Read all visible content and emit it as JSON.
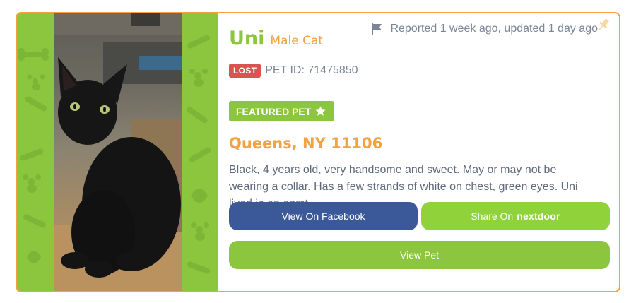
{
  "card": {
    "pet_name": "Uni",
    "pet_sex": "Male Cat",
    "status_badge": "LOST",
    "pet_id": "PET ID: 71475850",
    "reported": "Reported 1 week ago, updated 1 day ago",
    "featured_label": "FEATURED PET",
    "location": "Queens, NY 11106",
    "description": "Black, 4 years old, very handsome and sweet. May or may not be wearing a collar. Has a few strands of white on chest, green eyes. Uni lived in an apmt...",
    "buttons": {
      "facebook": "View On Facebook",
      "nextdoor_prefix": "Share On",
      "nextdoor_brand": "nextdoor",
      "view_pet": "View Pet"
    }
  },
  "icons": {
    "flag": "flag-icon",
    "star": "star-icon",
    "pin": "pin-icon"
  },
  "colors": {
    "border": "#f2a241",
    "green": "#8cc63f",
    "orange": "#f2a241",
    "lost_red": "#d9534f",
    "facebook_blue": "#3b5998",
    "nextdoor_green": "#8fd23a",
    "text_gray": "#5f6b7c"
  }
}
